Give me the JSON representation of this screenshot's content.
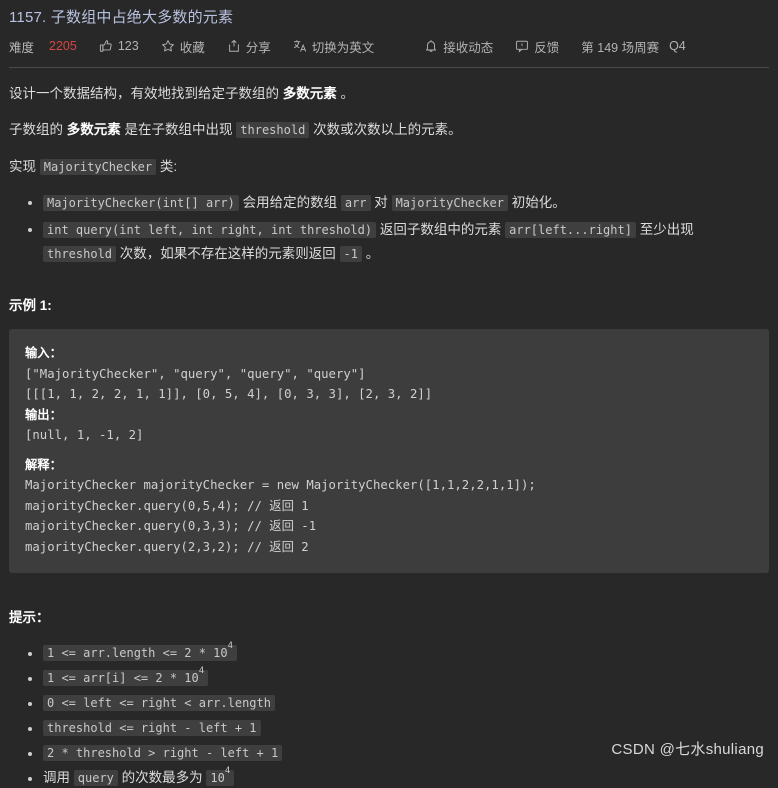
{
  "header": {
    "title": "1157. 子数组中占绝大多数的元素",
    "difficulty_label": "难度",
    "difficulty_value": "2205",
    "likes": "123",
    "favorite": "收藏",
    "share": "分享",
    "switch_lang": "切换为英文",
    "subscribe": "接收动态",
    "feedback": "反馈",
    "contest": "第 149 场周赛",
    "question_no": "Q4",
    "icons": {
      "thumbs_up": "thumbs-up-icon",
      "star": "star-icon",
      "share": "share-icon",
      "translate": "translate-icon",
      "bell": "bell-icon",
      "feedback": "feedback-icon"
    },
    "colors": {
      "title": "#b8c2e0",
      "difficulty": "#d64646",
      "background": "#282828",
      "code_block": "#3d3d3d",
      "inline_code": "#3f3f3f"
    }
  },
  "description": {
    "p1_a": "设计一个数据结构，有效地找到给定子数组的 ",
    "p1_b": "多数元素",
    "p1_c": " 。",
    "p2_a": "子数组的 ",
    "p2_b": "多数元素",
    "p2_c": " 是在子数组中出现 ",
    "p2_code": "threshold",
    "p2_d": " 次数或次数以上的元素。",
    "p3_a": "实现 ",
    "p3_code": "MajorityChecker",
    "p3_b": " 类:"
  },
  "spec_items": [
    {
      "code1": "MajorityChecker(int[] arr)",
      "t1": " 会用给定的数组 ",
      "code2": "arr",
      "t2": " 对 ",
      "code3": "MajorityChecker",
      "t3": " 初始化。"
    },
    {
      "code1": "int query(int left, int right, int threshold)",
      "t1": " 返回子数组中的元素 ",
      "code2": "arr[left...right]",
      "t2": " 至少出现 ",
      "code3": "threshold",
      "t3": " 次数，如果不存在这样的元素则返回 ",
      "code4": "-1",
      "t4": " 。"
    }
  ],
  "example": {
    "heading": "示例 1:",
    "input_label": "输入：",
    "input_line1": "[\"MajorityChecker\", \"query\", \"query\", \"query\"]",
    "input_line2": "[[[1, 1, 2, 2, 1, 1]], [0, 5, 4], [0, 3, 3], [2, 3, 2]]",
    "output_label": "输出：",
    "output_line": "[null, 1, -1, 2]",
    "explain_label": "解释：",
    "explain_lines": [
      "MajorityChecker majorityChecker = new MajorityChecker([1,1,2,2,1,1]);",
      "majorityChecker.query(0,5,4); // 返回 1",
      "majorityChecker.query(0,3,3); // 返回 -1",
      "majorityChecker.query(2,3,2); // 返回 2"
    ]
  },
  "hints": {
    "heading": "提示：",
    "items": [
      {
        "type": "code",
        "base": "1 <= arr.length <= 2 * 10",
        "sup": "4"
      },
      {
        "type": "code",
        "base": "1 <= arr[i] <= 2 * 10",
        "sup": "4"
      },
      {
        "type": "code",
        "base": "0 <= left <= right < arr.length",
        "sup": ""
      },
      {
        "type": "code",
        "base": "threshold <= right - left + 1",
        "sup": ""
      },
      {
        "type": "code",
        "base": "2 * threshold > right - left + 1",
        "sup": ""
      },
      {
        "type": "mixed",
        "pre": "调用 ",
        "code": "query",
        "mid": " 的次数最多为 ",
        "base": "10",
        "sup": "4"
      }
    ]
  },
  "watermark": "CSDN @七水shuliang"
}
